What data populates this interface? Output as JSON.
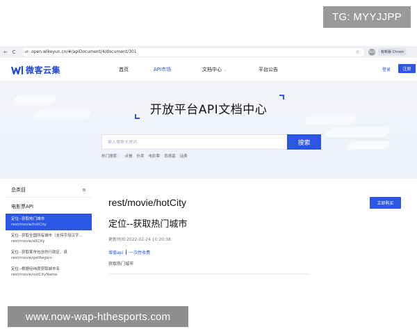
{
  "overlay": {
    "tg_label": "TG: MYYJJPP",
    "url_banner": "www.now-wap-hthesports.com"
  },
  "browser": {
    "back_icon": "←",
    "reload_icon": "C",
    "site_icon": "⇄",
    "url": "open.wikeyun.cn/#/apiDocument/4/document/301",
    "star_icon": "☆",
    "extension_label": "SEO",
    "new_version_label": "有新版 Chrom"
  },
  "topnav": {
    "logo_text": "微客云集",
    "items": [
      {
        "label": "首页"
      },
      {
        "label": "API市场"
      },
      {
        "label": "文档中心"
      },
      {
        "label": "平台公告"
      }
    ],
    "login_label": "登录",
    "register_label": "注册"
  },
  "hero": {
    "title": "开放平台API文档中心",
    "search_placeholder": "输入搜索关键词",
    "search_button": "搜索",
    "hot_label": "热门搜索：",
    "hot_terms": [
      "点餐",
      "外卖",
      "电影票",
      "肯德基",
      "话费"
    ]
  },
  "sidebar": {
    "title": "总类目",
    "category": "电影票API",
    "items": [
      {
        "title": "定位--获取热门城市",
        "path": "rest/movie/hotCity"
      },
      {
        "title": "定位--获取全国所有城市（支持字母汉字...",
        "path": "rest/movie/allCity"
      },
      {
        "title": "定位--获取某市包含的行政区、县",
        "path": "rest/movie/getRegion"
      },
      {
        "title": "定位--根据经纬度获取城市名",
        "path": "rest/movie/ostCityName"
      }
    ]
  },
  "content": {
    "api_path": "rest/movie/hotCity",
    "buy_button": "立即购买",
    "api_name": "定位--获取热门城市",
    "updated": "更新时间:2022-02-24 10:20:38",
    "tag1": "增值api",
    "tag2": "一次性收费",
    "description": "获取热门城市"
  },
  "colors": {
    "accent": "#2a55e5",
    "hero_bg": "#f3f5fb",
    "overlay_gray": "#9a9a9a"
  }
}
